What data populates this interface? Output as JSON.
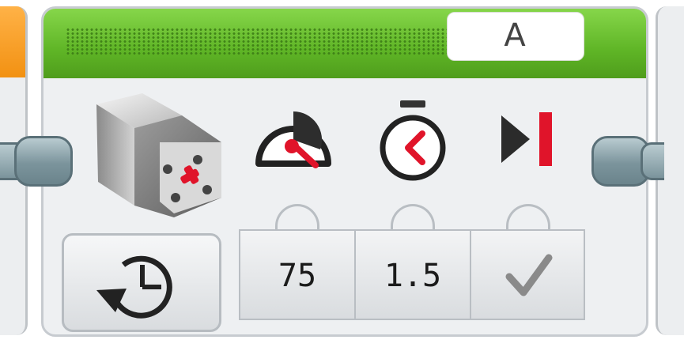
{
  "block": {
    "type": "Large Motor",
    "mode_icon": "rotate-seconds-icon",
    "port": {
      "label": "A"
    },
    "icons": [
      "motor-icon",
      "speed-icon",
      "timer-icon",
      "brake-icon"
    ],
    "params": {
      "speed": "75",
      "duration": "1.5",
      "brake_icon": "check-icon"
    },
    "colors": {
      "header_green": "#5fb526",
      "left_block_orange": "#f29112",
      "connector": "#7b949c",
      "accent_red": "#e0142a"
    }
  }
}
